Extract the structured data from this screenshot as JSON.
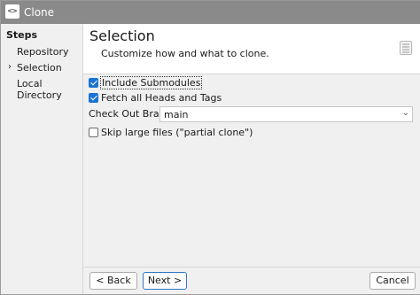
{
  "window": {
    "title": "Clone",
    "icon": "code-brackets-icon"
  },
  "sidebar": {
    "heading": "Steps",
    "items": [
      {
        "label": "Repository",
        "current": false
      },
      {
        "label": "Selection",
        "current": true,
        "marker": "›"
      },
      {
        "label": "Local Directory",
        "current": false
      }
    ]
  },
  "header": {
    "title": "Selection",
    "subtitle": "Customize how and what to clone.",
    "icon": "list-icon"
  },
  "options": {
    "include_submodules": {
      "label": "Include Submodules",
      "checked": true
    },
    "fetch_heads_tags": {
      "label": "Fetch all Heads and Tags",
      "checked": true
    },
    "checkout_branch": {
      "label": "Check Out Branch:",
      "value": "main"
    },
    "skip_large": {
      "label": "Skip large files (\"partial clone\")",
      "checked": false
    }
  },
  "buttons": {
    "back": "< Back",
    "next": "Next >",
    "cancel": "Cancel"
  },
  "colors": {
    "accent": "#1a73d4",
    "titlebar": "#8a8a8a"
  }
}
